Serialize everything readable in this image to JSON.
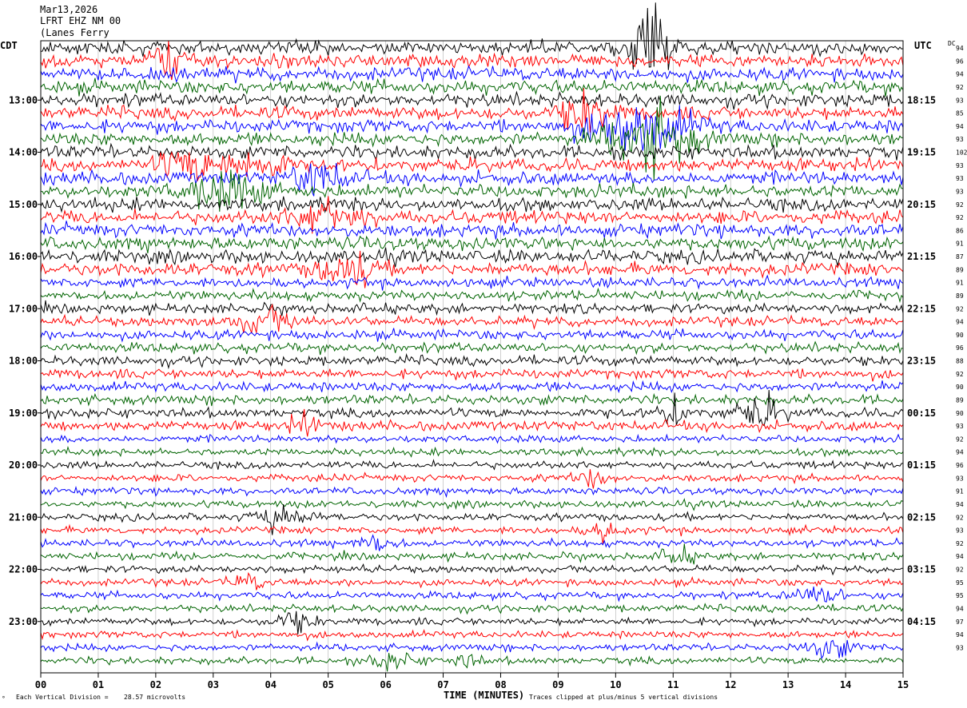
{
  "header": {
    "date": "Mar13,2026",
    "channel": "LFRT EHZ NM 00",
    "station": "(Lanes Ferry"
  },
  "left_timezone": "CDT",
  "right_timezone": "UTC",
  "dc_label": "DC",
  "footer": {
    "division_label": "Each Vertical Division =",
    "division_value": "28.57 microvolts",
    "clip_note": "Traces clipped at plus/minus 5 vertical divisions"
  },
  "colors": [
    "#000000",
    "#ff0000",
    "#0000ff",
    "#006400"
  ],
  "chart_data": {
    "type": "line",
    "title": "Mar13,2026 LFRT EHZ NM 00 (Lanes Ferry",
    "xlabel": "TIME (MINUTES)",
    "ylabel": "",
    "xlim": [
      0,
      15
    ],
    "x_ticks": [
      "00",
      "01",
      "02",
      "03",
      "04",
      "05",
      "06",
      "07",
      "08",
      "09",
      "10",
      "11",
      "12",
      "13",
      "14",
      "15"
    ],
    "rows": 48,
    "minutes_per_row": 15,
    "left_hour_labels": [
      "13:00",
      "14:00",
      "15:00",
      "16:00",
      "17:00",
      "18:00",
      "19:00",
      "20:00",
      "21:00",
      "22:00",
      "23:00"
    ],
    "right_hour_labels": [
      "18:15",
      "19:15",
      "20:15",
      "21:15",
      "22:15",
      "23:15",
      "00:15",
      "01:15",
      "02:15",
      "03:15",
      "04:15"
    ],
    "dc_offsets": [
      94,
      96,
      94,
      92,
      93,
      85,
      94,
      93,
      102,
      93,
      93,
      93,
      92,
      92,
      86,
      91,
      87,
      89,
      91,
      89,
      92,
      94,
      90,
      96,
      88,
      92,
      90,
      89,
      90,
      93,
      92,
      94,
      96,
      93,
      91,
      94,
      92,
      93,
      92,
      94,
      92,
      95,
      95,
      94,
      97,
      94,
      93
    ],
    "trace_colors_cycle": [
      "black",
      "red",
      "blue",
      "green"
    ],
    "division_microvolts": 28.57,
    "clip_divisions": 5
  }
}
